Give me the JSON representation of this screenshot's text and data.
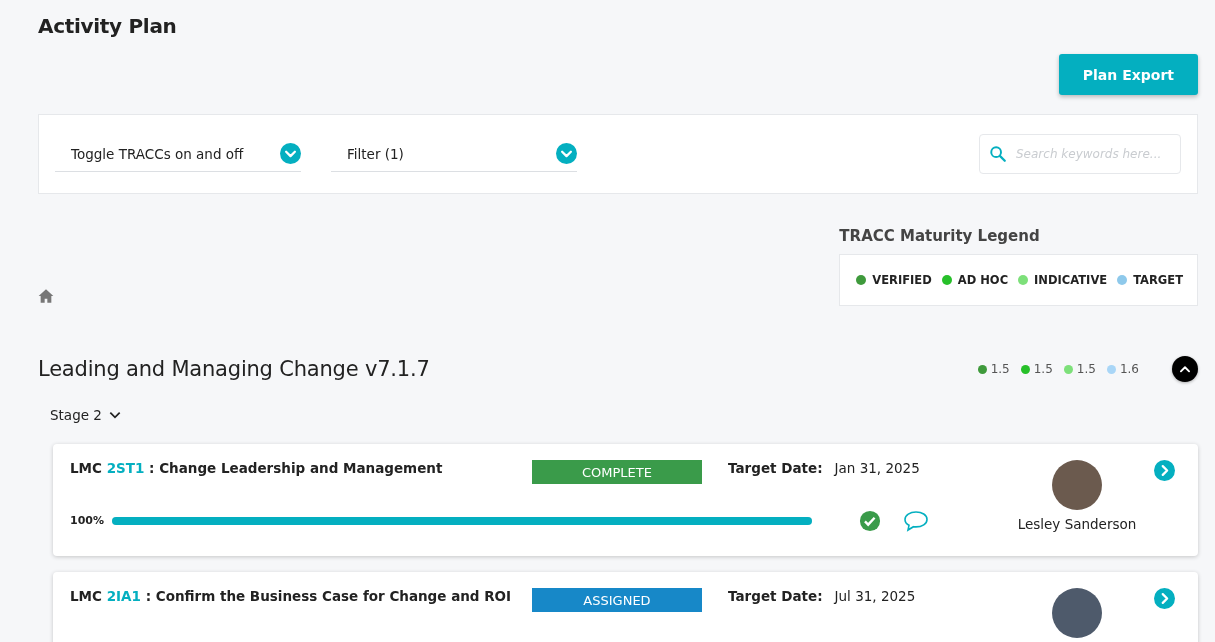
{
  "page": {
    "title": "Activity Plan"
  },
  "export_button": "Plan Export",
  "toolbar": {
    "toggle_dropdown": "Toggle TRACCs on and off",
    "filter_dropdown": "Filter (1)",
    "search": {
      "placeholder": "Search keywords here..."
    }
  },
  "legend": {
    "title": "TRACC Maturity Legend",
    "items": [
      {
        "label": "VERIFIED",
        "color": "#3f9a3c"
      },
      {
        "label": "AD HOC",
        "color": "#27c02a"
      },
      {
        "label": "INDICATIVE",
        "color": "#7de07a"
      },
      {
        "label": "TARGET",
        "color": "#8ec9eb"
      }
    ]
  },
  "section": {
    "title": "Leading and Managing Change v7.1.7",
    "expanded": true,
    "scores": [
      {
        "value": "1.5",
        "color": "#3f9a3c"
      },
      {
        "value": "1.5",
        "color": "#27c02a"
      },
      {
        "value": "1.5",
        "color": "#7de07a"
      },
      {
        "value": "1.6",
        "color": "#a9d6f7"
      }
    ]
  },
  "stage": {
    "label": "Stage 2"
  },
  "activities": [
    {
      "prefix": "LMC",
      "code": "2ST1",
      "title": ": Change Leadership and Management",
      "status": "COMPLETE",
      "color": "#3a9b4a",
      "target_label": "Target Date:",
      "target_date": "Jan 31, 2025",
      "progress": {
        "reading": "100%",
        "level": 1
      },
      "checked": true,
      "owner": "Lesley Sanderson"
    },
    {
      "prefix": "LMC",
      "code": "2IA1",
      "title": ": Confirm the Business Case for Change and ROI",
      "status": "ASSIGNED",
      "color": "#1788c8",
      "target_label": "Target Date:",
      "target_date": "Jul 31, 2025"
    }
  ]
}
